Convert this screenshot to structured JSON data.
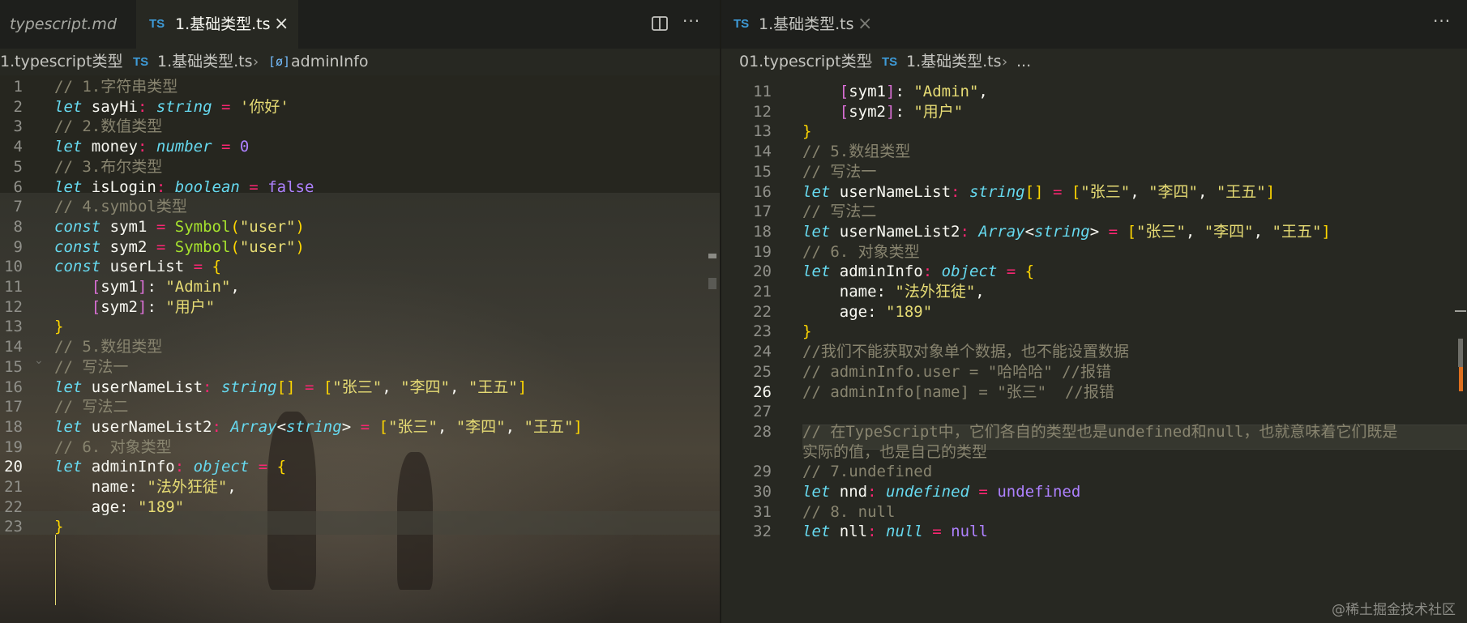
{
  "left": {
    "tabs": [
      {
        "label": "typescript.md",
        "active": false,
        "italic": true
      },
      {
        "badge": "TS",
        "label": "1.基础类型.ts",
        "active": true,
        "close": "×"
      }
    ],
    "toolbar": {
      "split_icon": "split-editor-icon",
      "more_icon": "more-actions-icon",
      "more_label": "···"
    },
    "breadcrumb": [
      {
        "label": "1.typescript类型"
      },
      {
        "sep": "›"
      },
      {
        "badge": "TS",
        "label": "1.基础类型.ts"
      },
      {
        "sep": "›"
      },
      {
        "symbol": "[ø]",
        "label": "adminInfo"
      }
    ],
    "current_line": 20,
    "lines": [
      {
        "n": 1,
        "t": [
          [
            "c",
            "// 1.字符串类型"
          ]
        ]
      },
      {
        "n": 2,
        "t": [
          [
            "k",
            "let"
          ],
          [
            "v",
            " sayHi"
          ],
          [
            "o",
            ":"
          ],
          [
            "v",
            " "
          ],
          [
            "ty",
            "string"
          ],
          [
            "v",
            " "
          ],
          [
            "o",
            "="
          ],
          [
            "v",
            " "
          ],
          [
            "s",
            "'你好'"
          ]
        ]
      },
      {
        "n": 3,
        "t": [
          [
            "c",
            "// 2.数值类型"
          ]
        ]
      },
      {
        "n": 4,
        "t": [
          [
            "k",
            "let"
          ],
          [
            "v",
            " money"
          ],
          [
            "o",
            ":"
          ],
          [
            "v",
            " "
          ],
          [
            "ty",
            "number"
          ],
          [
            "v",
            " "
          ],
          [
            "o",
            "="
          ],
          [
            "v",
            " "
          ],
          [
            "nm",
            "0"
          ]
        ]
      },
      {
        "n": 5,
        "t": [
          [
            "c",
            "// 3.布尔类型"
          ]
        ]
      },
      {
        "n": 6,
        "t": [
          [
            "k",
            "let"
          ],
          [
            "v",
            " isLogin"
          ],
          [
            "o",
            ":"
          ],
          [
            "v",
            " "
          ],
          [
            "ty",
            "boolean"
          ],
          [
            "v",
            " "
          ],
          [
            "o",
            "="
          ],
          [
            "v",
            " "
          ],
          [
            "cn",
            "false"
          ]
        ]
      },
      {
        "n": 7,
        "t": [
          [
            "c",
            "// 4.symbol类型"
          ]
        ]
      },
      {
        "n": 8,
        "t": [
          [
            "k",
            "const"
          ],
          [
            "v",
            " sym1 "
          ],
          [
            "o",
            "="
          ],
          [
            "v",
            " "
          ],
          [
            "f",
            "Symbol"
          ],
          [
            "b1",
            "("
          ],
          [
            "s",
            "\"user\""
          ],
          [
            "b1",
            ")"
          ]
        ]
      },
      {
        "n": 9,
        "t": [
          [
            "k",
            "const"
          ],
          [
            "v",
            " sym2 "
          ],
          [
            "o",
            "="
          ],
          [
            "v",
            " "
          ],
          [
            "f",
            "Symbol"
          ],
          [
            "b1",
            "("
          ],
          [
            "s",
            "\"user\""
          ],
          [
            "b1",
            ")"
          ]
        ]
      },
      {
        "n": 10,
        "t": [
          [
            "k",
            "const"
          ],
          [
            "v",
            " userList "
          ],
          [
            "o",
            "="
          ],
          [
            "v",
            " "
          ],
          [
            "b1",
            "{"
          ]
        ]
      },
      {
        "n": 11,
        "t": [
          [
            "v",
            "    "
          ],
          [
            "b2",
            "["
          ],
          [
            "v",
            "sym1"
          ],
          [
            "b2",
            "]"
          ],
          [
            "v",
            ": "
          ],
          [
            "s",
            "\"Admin\""
          ],
          [
            "v",
            ","
          ]
        ]
      },
      {
        "n": 12,
        "t": [
          [
            "v",
            "    "
          ],
          [
            "b2",
            "["
          ],
          [
            "v",
            "sym2"
          ],
          [
            "b2",
            "]"
          ],
          [
            "v",
            ": "
          ],
          [
            "s",
            "\"用户\""
          ]
        ]
      },
      {
        "n": 13,
        "t": [
          [
            "b1",
            "}"
          ]
        ]
      },
      {
        "n": 14,
        "t": [
          [
            "c",
            "// 5.数组类型"
          ]
        ]
      },
      {
        "n": 15,
        "t": [
          [
            "c",
            "// 写法一"
          ]
        ]
      },
      {
        "n": 16,
        "t": [
          [
            "k",
            "let"
          ],
          [
            "v",
            " userNameList"
          ],
          [
            "o",
            ":"
          ],
          [
            "v",
            " "
          ],
          [
            "ty",
            "string"
          ],
          [
            "b1",
            "[]"
          ],
          [
            "v",
            " "
          ],
          [
            "o",
            "="
          ],
          [
            "v",
            " "
          ],
          [
            "b1",
            "["
          ],
          [
            "s",
            "\"张三\""
          ],
          [
            "v",
            ", "
          ],
          [
            "s",
            "\"李四\""
          ],
          [
            "v",
            ", "
          ],
          [
            "s",
            "\"王五\""
          ],
          [
            "b1",
            "]"
          ]
        ]
      },
      {
        "n": 17,
        "t": [
          [
            "c",
            "// 写法二"
          ]
        ]
      },
      {
        "n": 18,
        "t": [
          [
            "k",
            "let"
          ],
          [
            "v",
            " userNameList2"
          ],
          [
            "o",
            ":"
          ],
          [
            "v",
            " "
          ],
          [
            "ty",
            "Array"
          ],
          [
            "v",
            "<"
          ],
          [
            "ty",
            "string"
          ],
          [
            "v",
            "> "
          ],
          [
            "o",
            "="
          ],
          [
            "v",
            " "
          ],
          [
            "b1",
            "["
          ],
          [
            "s",
            "\"张三\""
          ],
          [
            "v",
            ", "
          ],
          [
            "s",
            "\"李四\""
          ],
          [
            "v",
            ", "
          ],
          [
            "s",
            "\"王五\""
          ],
          [
            "b1",
            "]"
          ]
        ]
      },
      {
        "n": 19,
        "t": [
          [
            "c",
            "// 6. 对象类型"
          ]
        ]
      },
      {
        "n": 20,
        "t": [
          [
            "k",
            "let"
          ],
          [
            "v",
            " adminInfo"
          ],
          [
            "o",
            ":"
          ],
          [
            "v",
            " "
          ],
          [
            "ty",
            "object"
          ],
          [
            "v",
            " "
          ],
          [
            "o",
            "="
          ],
          [
            "v",
            " "
          ],
          [
            "b1",
            "{"
          ]
        ]
      },
      {
        "n": 21,
        "t": [
          [
            "v",
            "    name: "
          ],
          [
            "s",
            "\"法外狂徒\""
          ],
          [
            "v",
            ","
          ]
        ]
      },
      {
        "n": 22,
        "t": [
          [
            "v",
            "    age: "
          ],
          [
            "s",
            "\"189\""
          ]
        ]
      },
      {
        "n": 23,
        "t": [
          [
            "b1",
            "}"
          ]
        ]
      }
    ]
  },
  "right": {
    "tabs": [
      {
        "badge": "TS",
        "label": "1.基础类型.ts",
        "active": true,
        "close": "×"
      }
    ],
    "toolbar": {
      "more_icon": "more-actions-icon",
      "more_label": "···"
    },
    "breadcrumb": [
      {
        "label": "01.typescript类型"
      },
      {
        "sep": "›"
      },
      {
        "badge": "TS",
        "label": "1.基础类型.ts"
      },
      {
        "sep": "›"
      },
      {
        "label": "..."
      }
    ],
    "current_line": 26,
    "lines": [
      {
        "n": 11,
        "t": [
          [
            "v",
            "    "
          ],
          [
            "b2",
            "["
          ],
          [
            "v",
            "sym1"
          ],
          [
            "b2",
            "]"
          ],
          [
            "v",
            ": "
          ],
          [
            "s",
            "\"Admin\""
          ],
          [
            "v",
            ","
          ]
        ]
      },
      {
        "n": 12,
        "t": [
          [
            "v",
            "    "
          ],
          [
            "b2",
            "["
          ],
          [
            "v",
            "sym2"
          ],
          [
            "b2",
            "]"
          ],
          [
            "v",
            ": "
          ],
          [
            "s",
            "\"用户\""
          ]
        ]
      },
      {
        "n": 13,
        "t": [
          [
            "b1",
            "}"
          ]
        ]
      },
      {
        "n": 14,
        "t": [
          [
            "c",
            "// 5.数组类型"
          ]
        ]
      },
      {
        "n": 15,
        "t": [
          [
            "c",
            "// 写法一"
          ]
        ]
      },
      {
        "n": 16,
        "t": [
          [
            "k",
            "let"
          ],
          [
            "v",
            " userNameList"
          ],
          [
            "o",
            ":"
          ],
          [
            "v",
            " "
          ],
          [
            "ty",
            "string"
          ],
          [
            "b1",
            "[]"
          ],
          [
            "v",
            " "
          ],
          [
            "o",
            "="
          ],
          [
            "v",
            " "
          ],
          [
            "b1",
            "["
          ],
          [
            "s",
            "\"张三\""
          ],
          [
            "v",
            ", "
          ],
          [
            "s",
            "\"李四\""
          ],
          [
            "v",
            ", "
          ],
          [
            "s",
            "\"王五\""
          ],
          [
            "b1",
            "]"
          ]
        ]
      },
      {
        "n": 17,
        "t": [
          [
            "c",
            "// 写法二"
          ]
        ]
      },
      {
        "n": 18,
        "t": [
          [
            "k",
            "let"
          ],
          [
            "v",
            " userNameList2"
          ],
          [
            "o",
            ":"
          ],
          [
            "v",
            " "
          ],
          [
            "ty",
            "Array"
          ],
          [
            "v",
            "<"
          ],
          [
            "ty",
            "string"
          ],
          [
            "v",
            "> "
          ],
          [
            "o",
            "="
          ],
          [
            "v",
            " "
          ],
          [
            "b1",
            "["
          ],
          [
            "s",
            "\"张三\""
          ],
          [
            "v",
            ", "
          ],
          [
            "s",
            "\"李四\""
          ],
          [
            "v",
            ", "
          ],
          [
            "s",
            "\"王五\""
          ],
          [
            "b1",
            "]"
          ]
        ]
      },
      {
        "n": 19,
        "t": [
          [
            "c",
            "// 6. 对象类型"
          ]
        ]
      },
      {
        "n": 20,
        "t": [
          [
            "k",
            "let"
          ],
          [
            "v",
            " adminInfo"
          ],
          [
            "o",
            ":"
          ],
          [
            "v",
            " "
          ],
          [
            "ty",
            "object"
          ],
          [
            "v",
            " "
          ],
          [
            "o",
            "="
          ],
          [
            "v",
            " "
          ],
          [
            "b1",
            "{"
          ]
        ]
      },
      {
        "n": 21,
        "t": [
          [
            "v",
            "    name: "
          ],
          [
            "s",
            "\"法外狂徒\""
          ],
          [
            "v",
            ","
          ]
        ]
      },
      {
        "n": 22,
        "t": [
          [
            "v",
            "    age: "
          ],
          [
            "s",
            "\"189\""
          ]
        ]
      },
      {
        "n": 23,
        "t": [
          [
            "b1",
            "}"
          ]
        ]
      },
      {
        "n": 24,
        "t": [
          [
            "c",
            "//我们不能获取对象单个数据，也不能设置数据"
          ]
        ]
      },
      {
        "n": 25,
        "t": [
          [
            "c",
            "// adminInfo.user = \"哈哈哈\" //报错"
          ]
        ]
      },
      {
        "n": 26,
        "t": [
          [
            "c",
            "// adminInfo[name] = \"张三\"  //报错"
          ]
        ]
      },
      {
        "n": 27,
        "t": []
      },
      {
        "n": 28,
        "t": [
          [
            "c",
            "// 在TypeScript中，它们各自的类型也是undefined和null，也就意味着它们既是"
          ]
        ],
        "wrap": "实际的值，也是自己的类型"
      },
      {
        "n": 29,
        "t": [
          [
            "c",
            "// 7.undefined"
          ]
        ]
      },
      {
        "n": 30,
        "t": [
          [
            "k",
            "let"
          ],
          [
            "v",
            " nnd"
          ],
          [
            "o",
            ":"
          ],
          [
            "v",
            " "
          ],
          [
            "ty",
            "undefined"
          ],
          [
            "v",
            " "
          ],
          [
            "o",
            "="
          ],
          [
            "v",
            " "
          ],
          [
            "cn",
            "undefined"
          ]
        ]
      },
      {
        "n": 31,
        "t": [
          [
            "c",
            "// 8. null"
          ]
        ]
      },
      {
        "n": 32,
        "t": [
          [
            "k",
            "let"
          ],
          [
            "v",
            " nll"
          ],
          [
            "o",
            ":"
          ],
          [
            "v",
            " "
          ],
          [
            "ty",
            "null"
          ],
          [
            "v",
            " "
          ],
          [
            "o",
            "="
          ],
          [
            "v",
            " "
          ],
          [
            "cn",
            "null"
          ]
        ]
      }
    ]
  },
  "watermark": "@稀土掘金技术社区",
  "colors": {
    "editor_bg": "#272822",
    "comment": "#88846f",
    "keyword": "#66d9ef",
    "operator": "#f92672",
    "string": "#e6db74",
    "number": "#ae81ff",
    "function": "#a6e22e",
    "bracket1": "#ffd700",
    "bracket2": "#da70d6",
    "ts_badge": "#3e9bd8"
  }
}
